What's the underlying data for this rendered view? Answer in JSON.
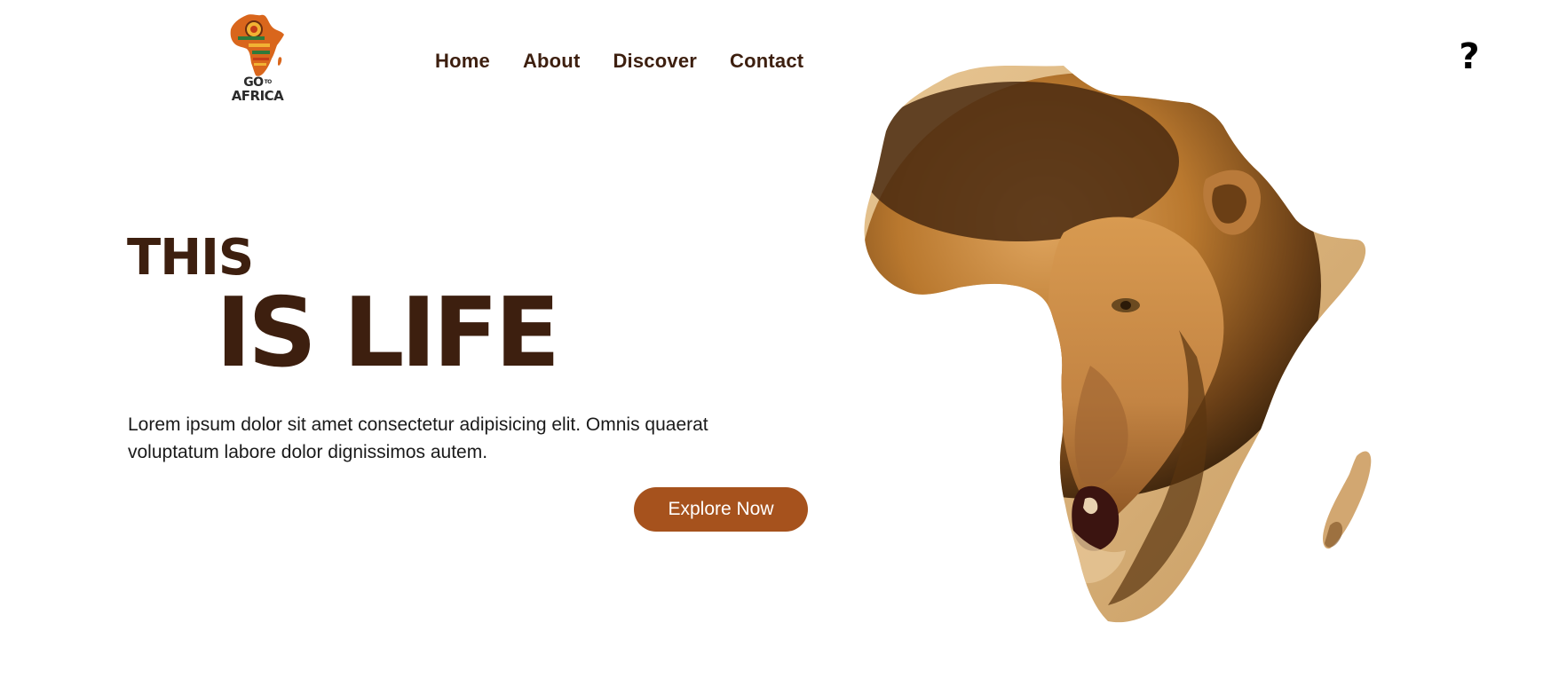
{
  "brand": {
    "logo_line1": "GO",
    "logo_line1_small": "TO",
    "logo_line2": "AFRICA"
  },
  "nav": {
    "items": [
      {
        "label": "Home"
      },
      {
        "label": "About"
      },
      {
        "label": "Discover"
      },
      {
        "label": "Contact"
      }
    ]
  },
  "header": {
    "help_glyph": "?"
  },
  "hero": {
    "title_line1": "THIS",
    "title_line2": "IS LIFE",
    "description": "Lorem ipsum dolor sit amet consectetur adipisicing elit. Omnis quaerat voluptatum labore dolor dignissimos autem.",
    "cta_label": "Explore Now"
  },
  "image": {
    "subject": "lion-in-africa-map-shape"
  },
  "colors": {
    "brand_brown": "#3d1f0f",
    "cta_background": "#a6521d",
    "cta_text": "#ffffff",
    "background": "#ffffff"
  }
}
